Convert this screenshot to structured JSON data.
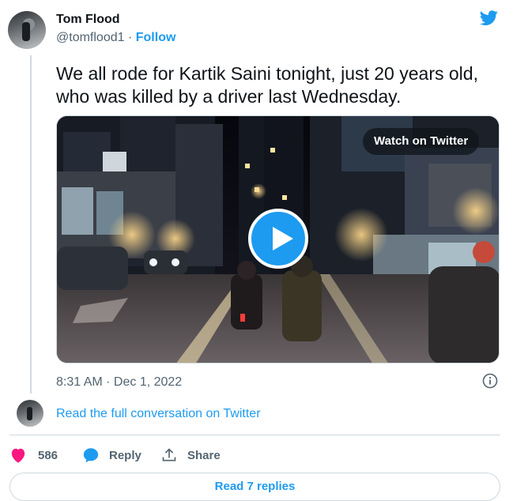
{
  "author": {
    "name": "Tom Flood",
    "handle": "@tomflood1",
    "separator": "·",
    "follow_label": "Follow"
  },
  "tweet": {
    "text": "We all rode for Kartik Saini tonight, just 20 years old, who was killed by a driver last Wednesday.",
    "timestamp": "8:31 AM · Dec 1, 2022"
  },
  "media": {
    "watch_label": "Watch on Twitter",
    "play_icon": "play-icon"
  },
  "conversation": {
    "read_full_label": "Read the full conversation on Twitter"
  },
  "actions": {
    "like_count": "586",
    "reply_label": "Reply",
    "share_label": "Share"
  },
  "footer": {
    "read_replies_label": "Read 7 replies"
  },
  "colors": {
    "brand": "#1d9bf0",
    "like": "#f91880",
    "text_primary": "#0f1419",
    "text_secondary": "#536471",
    "border": "#cfd9de"
  }
}
